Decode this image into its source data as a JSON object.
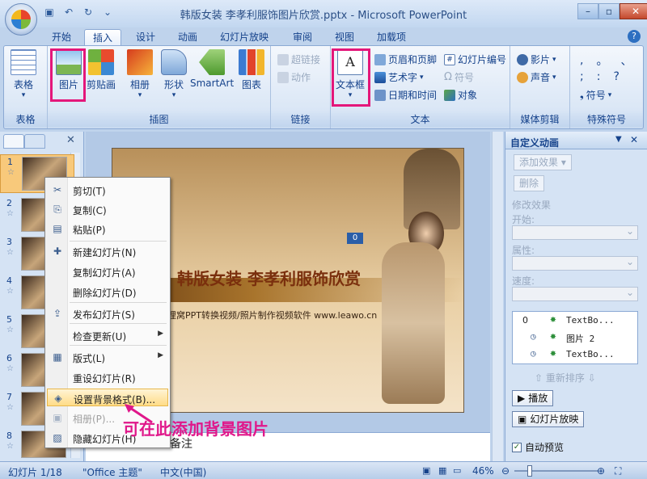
{
  "window": {
    "title": "韩版女装 李孝利服饰图片欣赏.pptx - Microsoft PowerPoint",
    "qat_icons": [
      "save-icon",
      "undo-icon",
      "redo-icon",
      "customize-icon"
    ]
  },
  "tabs": [
    {
      "label": "开始"
    },
    {
      "label": "插入",
      "active": true
    },
    {
      "label": "设计"
    },
    {
      "label": "动画"
    },
    {
      "label": "幻灯片放映"
    },
    {
      "label": "审阅"
    },
    {
      "label": "视图"
    },
    {
      "label": "加载项"
    }
  ],
  "ribbon": {
    "groups": {
      "table": "表格",
      "illustrations": "插图",
      "links": "链接",
      "text": "文本",
      "media": "媒体剪辑",
      "symbols": "特殊符号"
    },
    "buttons": {
      "table": "表格",
      "picture": "图片",
      "clipart": "剪贴画",
      "album": "相册",
      "shapes": "形状",
      "smartart": "SmartArt",
      "chart": "图表",
      "hyperlink": "超链接",
      "action": "动作",
      "textbox": "文本框",
      "header_footer": "页眉和页脚",
      "wordart": "艺术字",
      "datetime": "日期和时间",
      "slide_number": "幻灯片编号",
      "symbol": "符号",
      "object": "对象",
      "movie": "影片",
      "sound": "声音",
      "symbols_btn": "符号"
    },
    "punct": [
      ",",
      "。",
      "、",
      ";",
      ":",
      "?"
    ]
  },
  "slides": [
    {
      "num": "1",
      "selected": true
    },
    {
      "num": "2"
    },
    {
      "num": "3"
    },
    {
      "num": "4"
    },
    {
      "num": "5"
    },
    {
      "num": "6"
    },
    {
      "num": "7"
    },
    {
      "num": "8"
    }
  ],
  "slide": {
    "title": "韩版女装 李孝利服饰欣赏",
    "subtitle": "狸窝PPT转换视频/照片制作视频软件 www.leawo.cn",
    "counter": "0"
  },
  "notes": "备注",
  "context_menu": [
    {
      "icon": "✂",
      "label": "剪切(T)"
    },
    {
      "icon": "⎘",
      "label": "复制(C)"
    },
    {
      "icon": "▤",
      "label": "粘贴(P)"
    },
    {
      "sep": true
    },
    {
      "icon": "✚",
      "label": "新建幻灯片(N)"
    },
    {
      "icon": "",
      "label": "复制幻灯片(A)"
    },
    {
      "icon": "",
      "label": "删除幻灯片(D)"
    },
    {
      "sep": true
    },
    {
      "icon": "⇪",
      "label": "发布幻灯片(S)"
    },
    {
      "sep": true
    },
    {
      "icon": "",
      "label": "检查更新(U)",
      "arrow": true
    },
    {
      "sep": true
    },
    {
      "icon": "▦",
      "label": "版式(L)",
      "arrow": true
    },
    {
      "icon": "",
      "label": "重设幻灯片(R)"
    },
    {
      "icon": "◈",
      "label": "设置背景格式(B)...",
      "hover": true
    },
    {
      "icon": "▣",
      "label": "相册(P)...",
      "disabled": true
    },
    {
      "icon": "▨",
      "label": "隐藏幻灯片(H)"
    }
  ],
  "annotation": "可在此添加背景图片",
  "task_pane": {
    "title": "自定义动画",
    "add_effect": "添加效果",
    "remove": "删除",
    "modify": "修改效果",
    "start": "开始:",
    "property": "属性:",
    "speed": "速度:",
    "animations": [
      {
        "num": "0",
        "label": "TextBo..."
      },
      {
        "num": "",
        "label": "图片 2"
      },
      {
        "num": "",
        "label": "TextBo..."
      }
    ],
    "reorder": "重新排序",
    "play": "播放",
    "slideshow": "幻灯片放映",
    "autopreview": "自动预览"
  },
  "status": {
    "slide_info": "幻灯片 1/18",
    "theme": "\"Office 主题\"",
    "language": "中文(中国)",
    "zoom": "46%"
  }
}
